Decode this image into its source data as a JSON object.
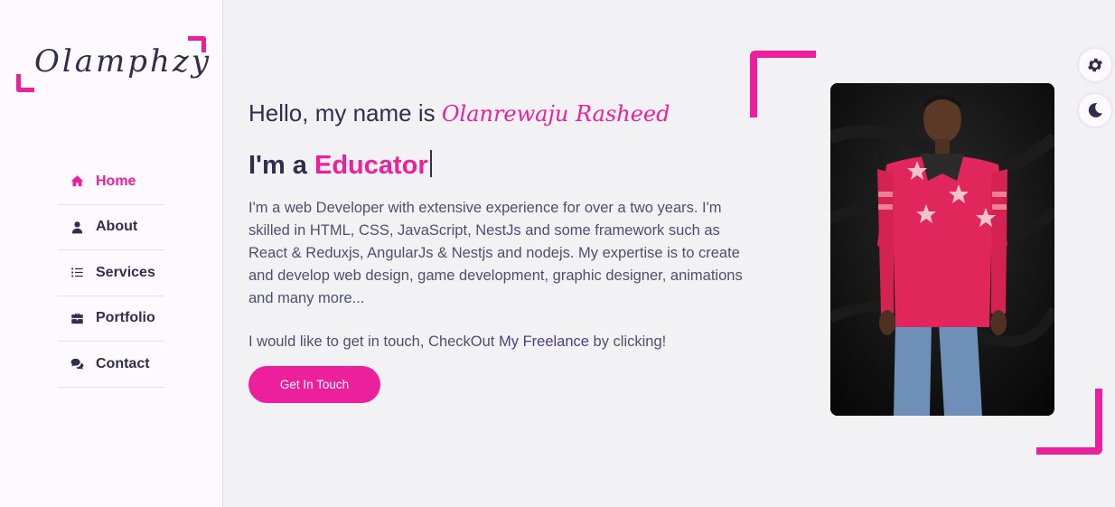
{
  "logo": {
    "text": "Olamphzy"
  },
  "nav": {
    "items": [
      {
        "label": "Home",
        "icon": "home-icon",
        "active": true
      },
      {
        "label": "About",
        "icon": "user-icon",
        "active": false
      },
      {
        "label": "Services",
        "icon": "list-icon",
        "active": false
      },
      {
        "label": "Portfolio",
        "icon": "briefcase-icon",
        "active": false
      },
      {
        "label": "Contact",
        "icon": "comments-icon",
        "active": false
      }
    ]
  },
  "home": {
    "hello_prefix": "Hello, my name is ",
    "name": "Olanrewaju Rasheed",
    "profession_prefix": "I'm a ",
    "profession": "Educator",
    "description": "I'm a web Developer with extensive experience for over a two years. I'm skilled in HTML, CSS, JavaScript, NestJs and some framework such as React & Reduxjs, AngularJs & Nestjs and nodejs. My expertise is to create and develop web design, game development, graphic designer, animations and many more...",
    "contact_prefix": "I would like to get in touch, CheckOut ",
    "contact_link": "My Freelance",
    "contact_suffix": " by clicking!",
    "button_label": "Get In Touch"
  },
  "switcher": {
    "settings_icon": "gear-icon",
    "theme_icon": "moon-icon"
  },
  "colors": {
    "accent": "#ec1f9c",
    "text": "#302e4d",
    "sidebar_bg": "#fdf9ff",
    "page_bg": "#f2f2f4"
  }
}
